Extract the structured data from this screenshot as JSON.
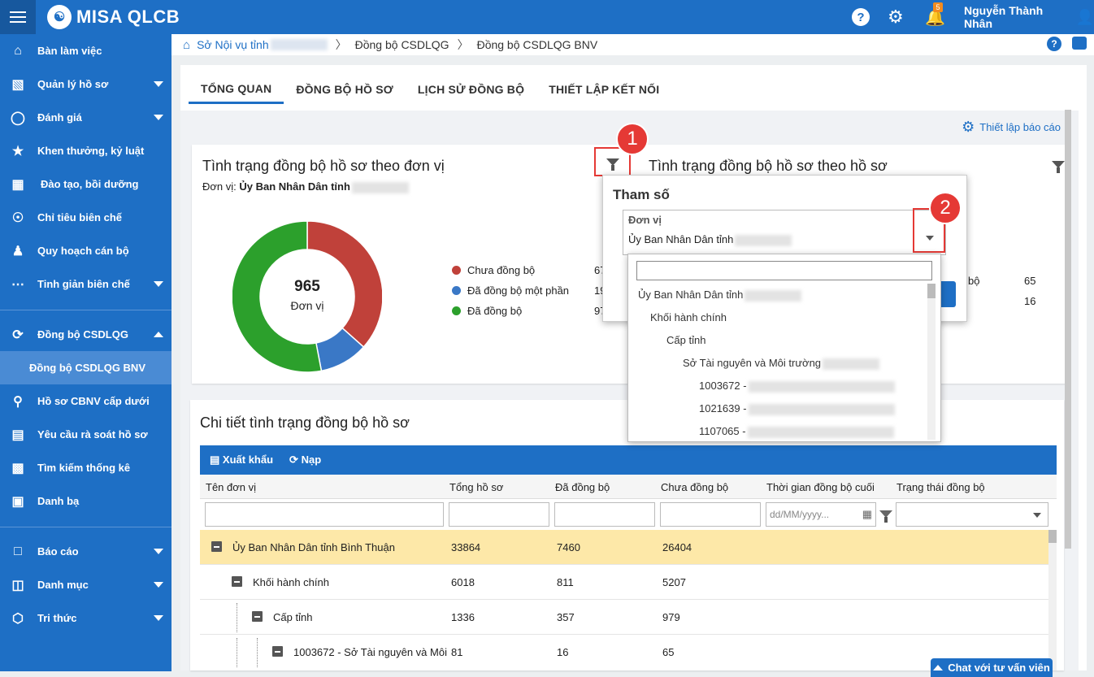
{
  "app": {
    "logo": "MISA QLCB",
    "user": "Nguyễn Thành Nhân",
    "notif_count": "5"
  },
  "sidebar": {
    "items": [
      {
        "label": "Bàn làm việc",
        "icon": "home-icon"
      },
      {
        "label": "Quản lý hồ sơ",
        "icon": "profile-icon"
      },
      {
        "label": "Đánh giá",
        "icon": "medal-icon"
      },
      {
        "label": "Khen thưởng, kỷ luật",
        "icon": "trophy-icon"
      },
      {
        "label": "Đào tạo, bồi dưỡng",
        "icon": "training-icon"
      },
      {
        "label": "Chỉ tiêu biên chế",
        "icon": "target-icon"
      },
      {
        "label": "Quy hoạch cán bộ",
        "icon": "people-icon"
      },
      {
        "label": "Tinh giản biên chế",
        "icon": "more-icon"
      },
      {
        "label": "Đồng bộ CSDLQG",
        "icon": "sync-icon"
      },
      {
        "label": "Đồng bộ CSDLQG BNV",
        "icon": ""
      },
      {
        "label": "Hồ sơ CBNV cấp dưới",
        "icon": "search-icon"
      },
      {
        "label": "Yêu cầu rà soát hồ sơ",
        "icon": "request-icon"
      },
      {
        "label": "Tìm kiếm thống kê",
        "icon": "chart-icon"
      },
      {
        "label": "Danh bạ",
        "icon": "contacts-icon"
      },
      {
        "label": "Báo cáo",
        "icon": "report-icon"
      },
      {
        "label": "Danh mục",
        "icon": "book-icon"
      },
      {
        "label": "Tri thức",
        "icon": "cube-icon"
      }
    ]
  },
  "breadcrumb": {
    "b1": "Sở Nội vụ tỉnh",
    "b2": "Đồng bộ CSDLQG",
    "b3": "Đồng bộ CSDLQG BNV"
  },
  "tabs": [
    "TỔNG QUAN",
    "ĐỒNG BỘ HỒ SƠ",
    "LỊCH SỬ ĐỒNG BỘ",
    "THIẾT LẬP KẾT NỐI"
  ],
  "setup_link": "Thiết lập báo cáo",
  "card_unit": {
    "title": "Tình trạng đồng bộ hồ sơ theo đơn vị",
    "unit_label": "Đơn vị:",
    "unit_value": "Ủy Ban Nhân Dân tỉnh",
    "total": "965",
    "total_label": "Đơn vị"
  },
  "card_profile": {
    "title": "Tình trạng đồng bộ hồ sơ theo hồ sơ",
    "row_label": "bộ",
    "v1": "65",
    "v2": "16"
  },
  "chart_data": {
    "type": "pie",
    "categories": [
      "Chưa đồng bộ",
      "Đã đồng bộ một phần",
      "Đã đồng bộ"
    ],
    "values": [
      67,
      19,
      97
    ],
    "value_labels": [
      "67",
      "19",
      "97"
    ],
    "colors": [
      "#c0413a",
      "#3a78c6",
      "#2ca02c"
    ]
  },
  "callouts": {
    "n1": "1",
    "n2": "2"
  },
  "popup": {
    "title": "Tham số",
    "field_label": "Đơn vị",
    "field_value": "Ủy Ban Nhân Dân tỉnh"
  },
  "dropdown": {
    "items": [
      "Ủy Ban Nhân Dân tỉnh",
      "Khối hành chính",
      "Cấp tỉnh",
      "Sở Tài nguyên và Môi trường",
      "1003672 -",
      "1021639 -",
      "1107065 -"
    ]
  },
  "detail": {
    "title": "Chi tiết tình trạng đồng bộ hồ sơ",
    "export": "Xuất khẩu",
    "reload": "Nạp",
    "columns": [
      "Tên đơn vị",
      "Tổng hồ sơ",
      "Đã đồng bộ",
      "Chưa đồng bộ",
      "Thời gian đồng bộ cuối",
      "Trạng thái đồng bộ"
    ],
    "date_placeholder": "dd/MM/yyyy...",
    "rows": [
      {
        "name": "Ủy Ban Nhân Dân tỉnh Bình Thuận",
        "total": "33864",
        "synced": "7460",
        "unsynced": "26404"
      },
      {
        "name": "Khối hành chính",
        "total": "6018",
        "synced": "811",
        "unsynced": "5207"
      },
      {
        "name": "Cấp tỉnh",
        "total": "1336",
        "synced": "357",
        "unsynced": "979"
      },
      {
        "name": "1003672 - Sở Tài nguyên và Môi",
        "total": "81",
        "synced": "16",
        "unsynced": "65"
      }
    ]
  },
  "chat": "Chat với tư vấn viên"
}
